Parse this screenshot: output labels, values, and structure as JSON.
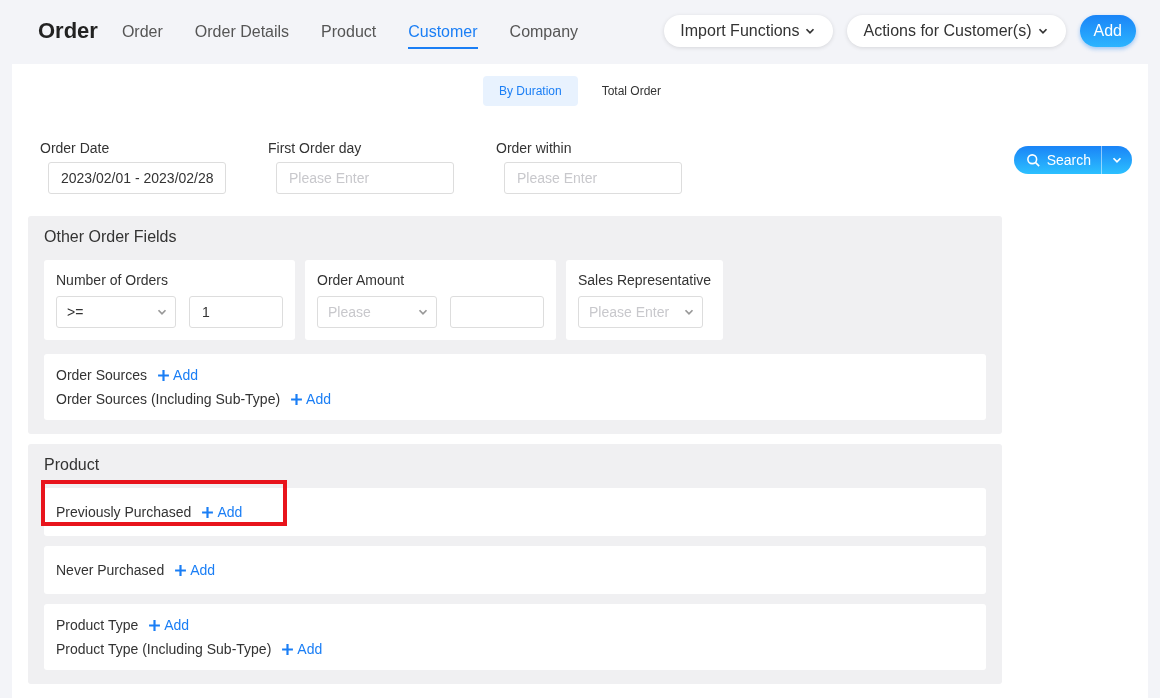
{
  "header": {
    "title": "Order",
    "tabs": [
      {
        "label": "Order",
        "selected": false
      },
      {
        "label": "Order Details",
        "selected": false
      },
      {
        "label": "Product",
        "selected": false
      },
      {
        "label": "Customer",
        "selected": true
      },
      {
        "label": "Company",
        "selected": false
      }
    ],
    "menus": [
      "Import Functions",
      "Actions for Customer(s)"
    ],
    "add_button": "Add"
  },
  "mode_tabs": [
    {
      "label": "By Duration",
      "selected": true
    },
    {
      "label": "Total Order",
      "selected": false
    }
  ],
  "filters": [
    {
      "label": "Order Date",
      "value": "2023/02/01 - 2023/02/28"
    },
    {
      "label": "First Order day",
      "placeholder": "Please Enter"
    },
    {
      "label": "Order within",
      "placeholder": "Please Enter"
    }
  ],
  "search_button": "Search",
  "sections": [
    {
      "title": "Other Order Fields",
      "fields": [
        {
          "label": "Number of Orders",
          "kind": "select-input",
          "select": {
            "value": ">="
          },
          "input": {
            "value": "1"
          }
        },
        {
          "label": "Order Amount",
          "kind": "select-input",
          "select": {
            "placeholder": "Please"
          }
        },
        {
          "label": "Sales Representative",
          "kind": "select",
          "select": {
            "placeholder": "Please Enter"
          }
        }
      ],
      "groups": [
        {
          "rows": [
            {
              "label": "Order Sources",
              "add": "Add",
              "highlighted": false
            },
            {
              "label": "Order Sources (Including Sub-Type)",
              "add": "Add",
              "highlighted": false
            }
          ]
        }
      ]
    },
    {
      "title": "Product",
      "groups": [
        {
          "rows": [
            {
              "label": "Previously Purchased",
              "add": "Add",
              "highlighted": true
            }
          ]
        },
        {
          "rows": [
            {
              "label": "Never Purchased",
              "add": "Add",
              "highlighted": false
            }
          ]
        },
        {
          "rows": [
            {
              "label": "Product Type",
              "add": "Add",
              "highlighted": false
            },
            {
              "label": "Product Type (Including Sub-Type)",
              "add": "Add",
              "highlighted": false
            }
          ]
        }
      ]
    }
  ]
}
